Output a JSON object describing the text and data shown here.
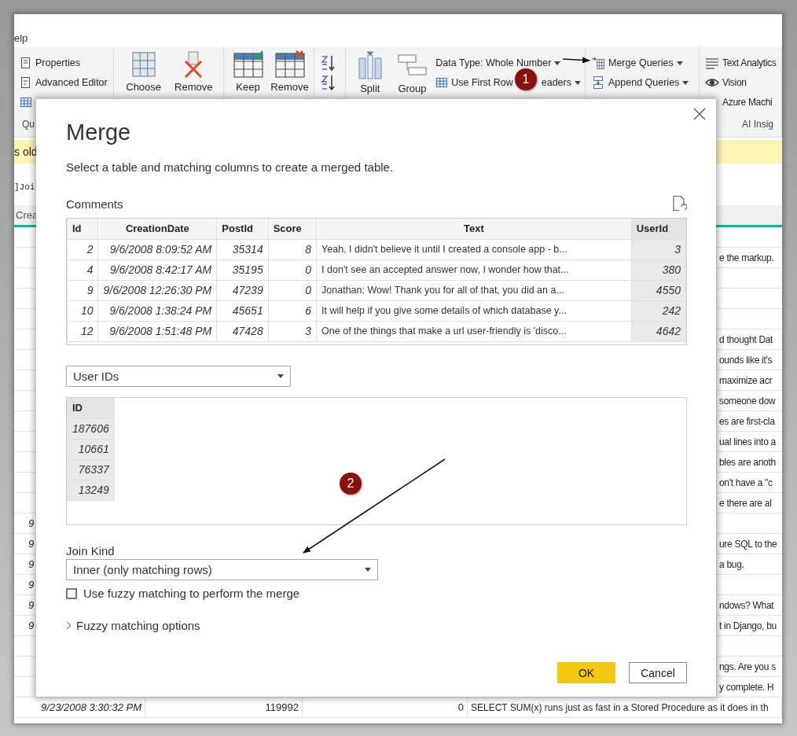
{
  "menu": {
    "tab": "elp"
  },
  "ribbon": {
    "groups": [
      {
        "label": "Qu",
        "items": [
          {
            "kind": "small",
            "label": "Properties"
          },
          {
            "kind": "small",
            "label": "Advanced Editor"
          },
          {
            "kind": "icon"
          }
        ]
      },
      {
        "items": [
          {
            "kind": "large",
            "label": "Choose"
          },
          {
            "kind": "large",
            "label": "Remove"
          }
        ]
      },
      {
        "items": [
          {
            "kind": "large",
            "label": "Keep"
          },
          {
            "kind": "large",
            "label": "Remove"
          }
        ]
      },
      {
        "items": [
          {
            "kind": "icon"
          },
          {
            "kind": "icon"
          }
        ]
      },
      {
        "items": [
          {
            "kind": "large",
            "label": "Split"
          },
          {
            "kind": "large",
            "label": "Group"
          },
          {
            "kind": "dropdown",
            "label": "Data Type: Whole Number"
          },
          {
            "kind": "dropdown",
            "label": "Use First Row",
            "label_after": "eaders"
          }
        ]
      },
      {
        "items": [
          {
            "kind": "dropdown",
            "label": "Merge Queries"
          },
          {
            "kind": "dropdown",
            "label": "Append Queries"
          }
        ]
      },
      {
        "label": "AI Insig",
        "items": [
          {
            "kind": "small",
            "label": "Text Analytics"
          },
          {
            "kind": "small",
            "label": "Vision"
          },
          {
            "kind": "small",
            "label": "Azure Machi"
          }
        ]
      }
    ]
  },
  "banner": {
    "text": "s old"
  },
  "formula": {
    "text": "]Joi"
  },
  "grid": {
    "header": "Crea",
    "rows": [
      {
        "kind": "partial"
      },
      {
        "kind": "partial",
        "column_4": "e the markup."
      },
      {
        "kind": "partial"
      },
      {
        "kind": "partial"
      },
      {
        "kind": "partial"
      },
      {
        "kind": "partial",
        "column_4": "d thought Dat"
      },
      {
        "kind": "partial",
        "column_4": "ounds like it's"
      },
      {
        "kind": "partial",
        "column_4": "maximize acr"
      },
      {
        "kind": "partial",
        "column_4": "someone dow"
      },
      {
        "kind": "partial",
        "column_4": "es are first-cla"
      },
      {
        "kind": "partial",
        "column_4": "ual lines into a"
      },
      {
        "kind": "partial",
        "column_4": "bles are anoth"
      },
      {
        "kind": "partial",
        "column_4": "on't have a \"c"
      },
      {
        "kind": "partial",
        "column_4": "e there are al"
      },
      {
        "kind": "partial",
        "column_1": "9"
      },
      {
        "kind": "partial",
        "column_1": "9",
        "column_4": "ure SQL to the"
      },
      {
        "kind": "partial",
        "column_1": "9",
        "column_4": "a bug."
      },
      {
        "kind": "partial",
        "column_1": "9"
      },
      {
        "kind": "partial",
        "column_1": "9",
        "column_4": "ndows?  What"
      },
      {
        "kind": "partial",
        "column_1": "9",
        "column_4": "t in Django, bu"
      },
      {
        "kind": "partial"
      },
      {
        "kind": "partial",
        "column_4": "ngs.  Are you s"
      },
      {
        "kind": "partial",
        "column_4": "y complete.  H"
      },
      {
        "kind": "full",
        "column_1": "9/23/2008 3:30:32 PM",
        "column_2": "119992",
        "column_3": "0",
        "column_4": "SELECT SUM(x) runs just as fast in a Stored Procedure as it does in th"
      }
    ]
  },
  "dialog": {
    "title": "Merge",
    "subtitle": "Select a table and matching columns to create a merged table.",
    "first_table": {
      "name": "Comments",
      "columns": [
        {
          "label": "Id",
          "kind": "number",
          "selected": false
        },
        {
          "label": "CreationDate",
          "kind": "number",
          "selected": false
        },
        {
          "label": "PostId",
          "kind": "number",
          "selected": false
        },
        {
          "label": "Score",
          "kind": "number",
          "selected": false
        },
        {
          "label": "Text",
          "kind": "text",
          "selected": false
        },
        {
          "label": "UserId",
          "kind": "number",
          "selected": true
        }
      ],
      "rows": [
        [
          "2",
          "9/6/2008 8:09:52 AM",
          "35314",
          "8",
          "Yeah, I didn't believe it until I created a console app - b...",
          "3"
        ],
        [
          "4",
          "9/6/2008 8:42:17 AM",
          "35195",
          "0",
          "I don't see an accepted answer now, I wonder how that...",
          "380"
        ],
        [
          "9",
          "9/6/2008 12:26:30 PM",
          "47239",
          "0",
          "Jonathan: Wow! Thank you for all of that, you did an a...",
          "4550"
        ],
        [
          "10",
          "9/6/2008 1:38:24 PM",
          "45651",
          "6",
          "It will help if you give some details of which database y...",
          "242"
        ],
        [
          "12",
          "9/6/2008 1:51:48 PM",
          "47428",
          "3",
          "One of the things that make a url user-friendly is 'disco...",
          "4642"
        ]
      ]
    },
    "second_table": {
      "dropdown": "User IDs",
      "columns": [
        {
          "label": "ID",
          "kind": "number",
          "selected": true
        }
      ],
      "rows": [
        [
          "187606"
        ],
        [
          "10661"
        ],
        [
          "76337"
        ],
        [
          "13249"
        ]
      ]
    },
    "join_kind": {
      "label": "Join Kind",
      "value": "Inner (only matching rows)"
    },
    "fuzzy": {
      "label": "Use fuzzy matching to perform the merge",
      "checked": false
    },
    "fuzzy_options": {
      "label": "Fuzzy matching options",
      "expanded": false
    },
    "buttons": [
      {
        "label": "OK",
        "kind": "primary"
      },
      {
        "label": "Cancel",
        "kind": "secondary"
      }
    ]
  },
  "annotations": [
    {
      "number": "1"
    },
    {
      "number": "2"
    }
  ]
}
